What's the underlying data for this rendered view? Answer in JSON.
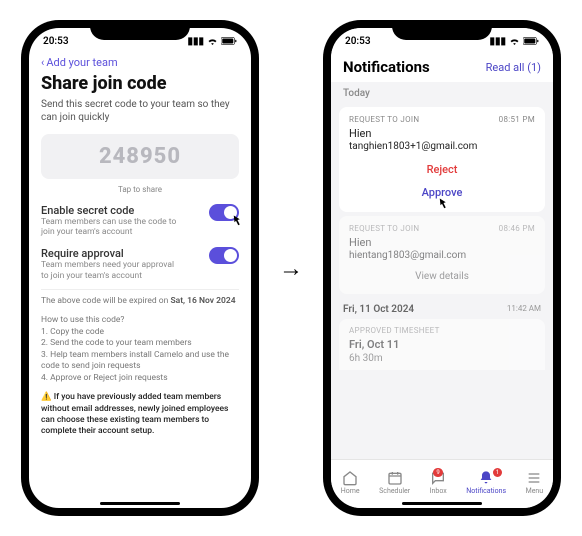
{
  "phone1": {
    "status": {
      "time": "20:53"
    },
    "nav": {
      "back": "Add your team"
    },
    "title": "Share join code",
    "subtitle": "Send this secret code to your team so they can join quickly",
    "code": "248950",
    "tap_to_share": "Tap to share",
    "toggles": [
      {
        "label": "Enable secret code",
        "desc": "Team members can use the code to join your team's account"
      },
      {
        "label": "Require approval",
        "desc": "Team members need your approval to join your team's account"
      }
    ],
    "expiry_prefix": "The above code will be expired on ",
    "expiry_date": "Sat, 16 Nov 2024",
    "howto_title": "How to use this code?",
    "howto_steps": [
      "1. Copy the code",
      "2. Send the code to your team members",
      "3. Help team members install Camelo and use the code to send join requests",
      "4. Approve or Reject join requests"
    ],
    "warning": "⚠️ If you have previously added team members without email addresses, newly joined employees can choose these existing team members to complete their account setup."
  },
  "phone2": {
    "status": {
      "time": "20:53"
    },
    "nav": {
      "title": "Notifications",
      "action": "Read all (1)"
    },
    "today_label": "Today",
    "requests": [
      {
        "type": "REQUEST TO JOIN",
        "time": "08:51 PM",
        "name": "Hien",
        "email": "tanghien1803+1@gmail.com",
        "reject": "Reject",
        "approve": "Approve"
      },
      {
        "type": "REQUEST TO JOIN",
        "time": "08:46 PM",
        "name": "Hien",
        "email": "hientang1803@gmail.com",
        "view": "View details"
      }
    ],
    "prev_date": {
      "label": "Fri, 11 Oct 2024",
      "time": "11:42 AM"
    },
    "timesheet": {
      "type": "APPROVED TIMESHEET",
      "date": "Fri, Oct 11",
      "duration": "6h 30m"
    },
    "tabs": [
      {
        "label": "Home"
      },
      {
        "label": "Scheduler"
      },
      {
        "label": "Inbox",
        "badge": "9"
      },
      {
        "label": "Notifications",
        "badge": "1"
      },
      {
        "label": "Menu"
      }
    ]
  }
}
